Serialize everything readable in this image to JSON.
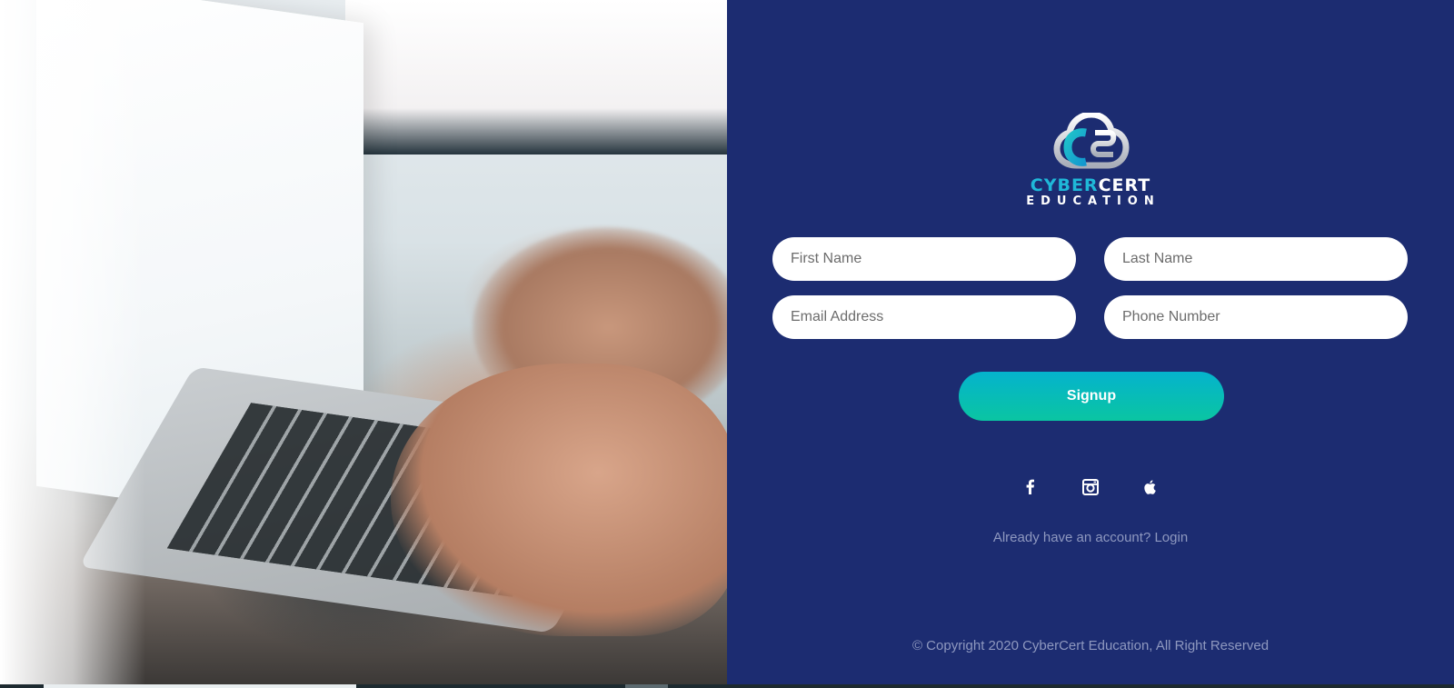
{
  "brand": {
    "word_part1": "CYBER",
    "word_part2": "CERT",
    "subtitle": "EDUCATION"
  },
  "form": {
    "first_name_placeholder": "First Name",
    "last_name_placeholder": "Last Name",
    "email_placeholder": "Email Address",
    "phone_placeholder": "Phone Number",
    "submit_label": "Signup"
  },
  "social": [
    {
      "icon": "facebook-icon"
    },
    {
      "icon": "instagram-icon"
    },
    {
      "icon": "apple-icon"
    }
  ],
  "login": {
    "prompt": "Already have an account?",
    "link_label": "Login"
  },
  "footer": {
    "copyright": "© Copyright 2020 CyberCert Education, All Right Reserved"
  },
  "colors": {
    "panel_bg": "#1c2c71",
    "accent_teal": "#05b3cd",
    "accent_green": "#0ac5a2",
    "muted_text": "#8e98bf"
  }
}
